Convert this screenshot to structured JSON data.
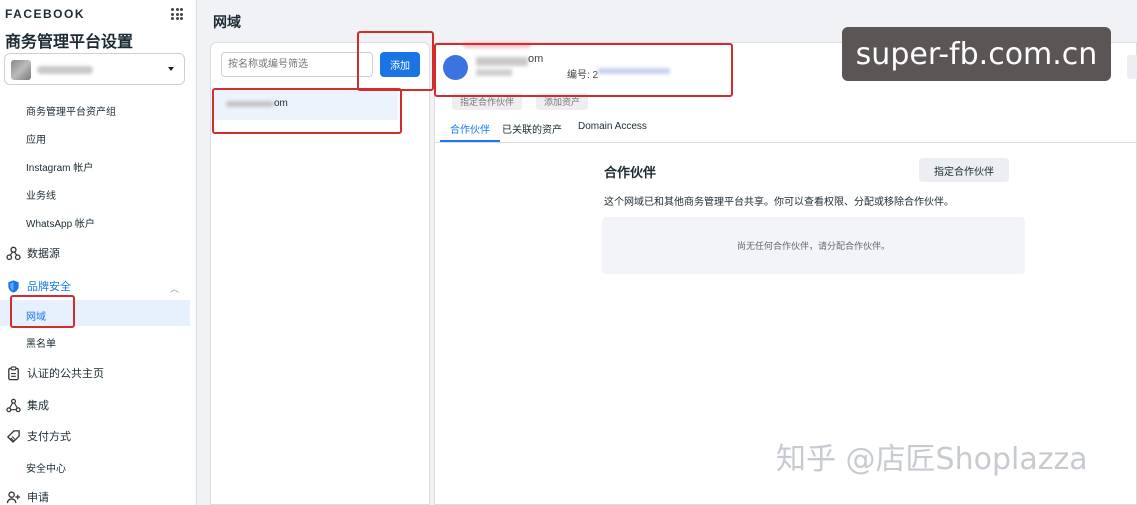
{
  "sidebar": {
    "brand": "FACEBOOK",
    "title": "商务管理平台设置",
    "sub_items_top": [
      "商务管理平台资产组",
      "应用",
      "Instagram 帐户",
      "业务线",
      "WhatsApp 帐户"
    ],
    "data_source": "数据源",
    "brand_safety": "品牌安全",
    "brand_safety_items": [
      "网域",
      "黑名单"
    ],
    "verified_pages": "认证的公共主页",
    "integrations": "集成",
    "payment": "支付方式",
    "security_center": "安全中心",
    "requests": "申请"
  },
  "main": {
    "page_title": "网域",
    "filter_placeholder": "按名称或编号筛选",
    "add_button": "添加",
    "list": [
      {
        "suffix": "om"
      }
    ],
    "detail": {
      "name_suffix": "om",
      "id_label": "编号: 2",
      "hidden_buttons": [
        "指定合作伙伴",
        "添加资产"
      ],
      "tabs": [
        "合作伙伴",
        "已关联的资产",
        "Domain Access"
      ],
      "active_tab": 0,
      "partners_title": "合作伙伴",
      "assign_partner_button": "指定合作伙伴",
      "partners_description": "这个网域已和其他商务管理平台共享。你可以查看权限、分配或移除合作伙伴。",
      "empty_text": "尚无任何合作伙伴，请分配合作伙伴。"
    }
  },
  "watermarks": {
    "site": "super-fb.com.cn",
    "zhihu": "知乎 @店匠Shoplazza"
  },
  "colors": {
    "accent": "#1877f2",
    "button_primary": "#1b74e4",
    "highlight": "#d22c2c"
  }
}
